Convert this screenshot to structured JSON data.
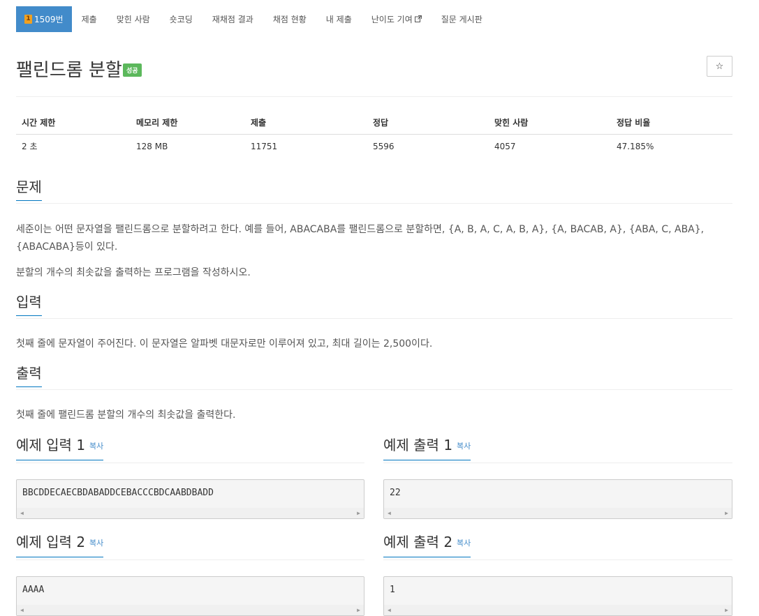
{
  "nav": {
    "problem_tab": "1509번",
    "tier_glyph": "1",
    "items": [
      "제출",
      "맞힌 사람",
      "숏코딩",
      "재채점 결과",
      "채점 현황",
      "내 제출",
      "난이도 기여",
      "질문 게시판"
    ]
  },
  "title": {
    "text": "팰린드롬 분할",
    "badge": "성공",
    "star": "☆"
  },
  "stats": {
    "headers": [
      "시간 제한",
      "메모리 제한",
      "제출",
      "정답",
      "맞힌 사람",
      "정답 비율"
    ],
    "values": [
      "2 초",
      "128 MB",
      "11751",
      "5596",
      "4057",
      "47.185%"
    ]
  },
  "sections": {
    "problem": {
      "heading": "문제",
      "p1": "세준이는 어떤 문자열을 팰린드롬으로 분할하려고 한다. 예를 들어, ABACABA를 팰린드롬으로 분할하면, {A, B, A, C, A, B, A}, {A, BACAB, A}, {ABA, C, ABA}, {ABACABA}등이 있다.",
      "p2": "분할의 개수의 최솟값을 출력하는 프로그램을 작성하시오."
    },
    "input": {
      "heading": "입력",
      "p1": "첫째 줄에 문자열이 주어진다. 이 문자열은 알파벳 대문자로만 이루어져 있고, 최대 길이는 2,500이다."
    },
    "output": {
      "heading": "출력",
      "p1": "첫째 줄에 팰린드롬 분할의 개수의 최솟값을 출력한다."
    }
  },
  "samples": {
    "copy_label": "복사",
    "in1": {
      "title": "예제 입력 1",
      "value": "BBCDDECAECBDABADDCEBACCCBDCAABDBADD"
    },
    "out1": {
      "title": "예제 출력 1",
      "value": "22"
    },
    "in2": {
      "title": "예제 입력 2",
      "value": "AAAA"
    },
    "out2": {
      "title": "예제 출력 2",
      "value": "1"
    }
  },
  "colors": {
    "nav_active": "#428bca",
    "badge_success": "#5cb85c",
    "heading_underline": "#0076c0"
  }
}
